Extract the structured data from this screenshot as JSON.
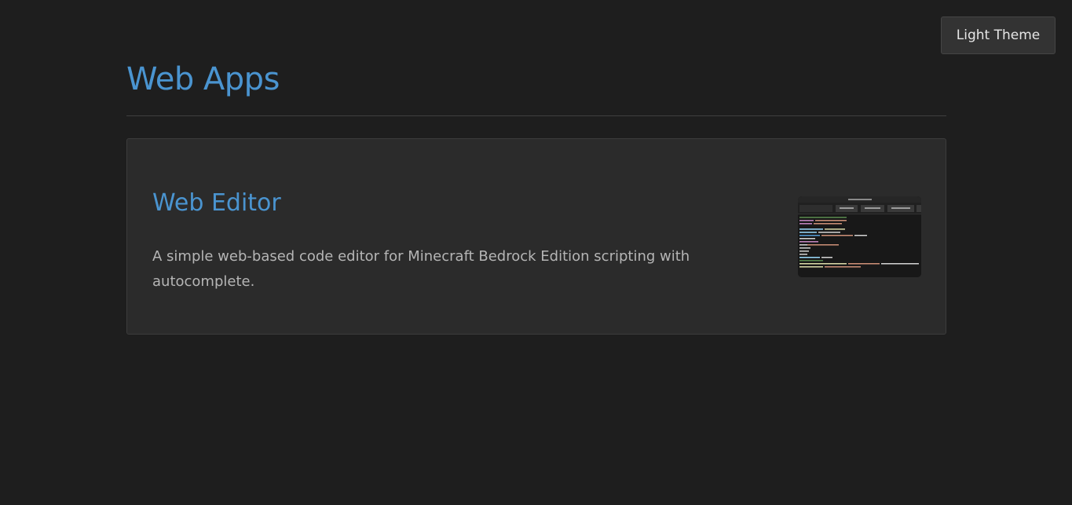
{
  "header": {
    "theme_toggle_label": "Light Theme"
  },
  "page": {
    "title": "Web Apps"
  },
  "apps": [
    {
      "title": "Web Editor",
      "description": "A simple web-based code editor for Minecraft Bedrock Edition scripting with autocomplete."
    }
  ],
  "colors": {
    "background": "#1e1e1e",
    "card_background": "#2b2b2b",
    "accent": "#4a94d0",
    "text_muted": "#b5b5b5"
  }
}
